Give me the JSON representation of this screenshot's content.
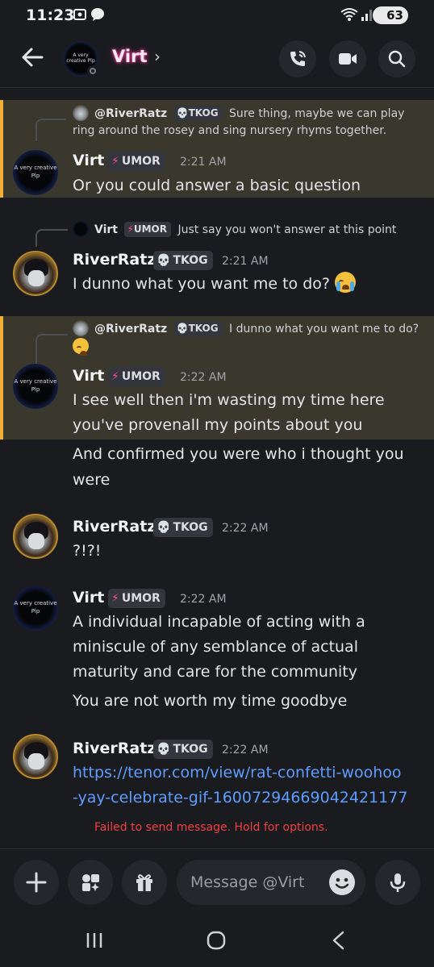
{
  "status_bar": {
    "time": "11:23",
    "battery": "63"
  },
  "header": {
    "name": "Virt",
    "avatar_text": "A very creative Plp"
  },
  "messages": [
    {
      "reply": {
        "name": "@RiverRatz",
        "tag": "TKOG",
        "text": "Sure thing, maybe we can play",
        "text2": "ring around the rosey and sing nursery rhyms together."
      },
      "author": "Virt",
      "tag": "UMOR",
      "time": "2:21 AM",
      "avatar_text": "A very creative Plp",
      "lines": [
        "Or you could answer a basic question"
      ]
    },
    {
      "reply": {
        "name": "Virt",
        "tag": "UMOR",
        "text": "Just say you won't answer at this point"
      },
      "author": "RiverRatz",
      "tag": "TKOG",
      "time": "2:21 AM",
      "lines": [
        "I dunno what you want me to do?"
      ]
    },
    {
      "reply": {
        "name": "@RiverRatz",
        "tag": "TKOG",
        "text": "I dunno what you want me to do?"
      },
      "author": "Virt",
      "tag": "UMOR",
      "time": "2:22 AM",
      "avatar_text": "A very creative Plp",
      "lines": [
        "I see well then i'm wasting my time here",
        "you've provenall my points about you"
      ],
      "followups": [
        "And confirmed you were who i thought you",
        "were"
      ]
    },
    {
      "author": "RiverRatz",
      "tag": "TKOG",
      "time": "2:22 AM",
      "lines": [
        "?!?!"
      ]
    },
    {
      "author": "Virt",
      "tag": "UMOR",
      "time": "2:22 AM",
      "avatar_text": "A very creative Plp",
      "lines": [
        "A individual incapable of acting with a",
        "miniscule of any semblance of actual",
        "maturity and care for the community"
      ],
      "followups": [
        "You are not worth my time goodbye"
      ]
    },
    {
      "author": "RiverRatz",
      "tag": "TKOG",
      "time": "2:22 AM",
      "link": [
        "https://tenor.com/view/rat-confetti-woohoo",
        "-yay-celebrate-gif-16007294669042421177"
      ],
      "error": "Failed to send message. Hold for options."
    }
  ],
  "composer": {
    "placeholder": "Message @Virt"
  },
  "colors": {
    "mention_highlight": "#3a372c",
    "mention_bar": "#f0b232",
    "link": "#5e9dff",
    "error": "#f23f43",
    "name_glow": "#ff3c9a"
  },
  "icons": [
    "back-arrow-icon",
    "phone-call-icon",
    "video-icon",
    "search-icon",
    "plus-icon",
    "apps-icon",
    "gift-icon",
    "emoji-icon",
    "microphone-icon",
    "recents-icon",
    "home-icon",
    "nav-back-icon"
  ]
}
